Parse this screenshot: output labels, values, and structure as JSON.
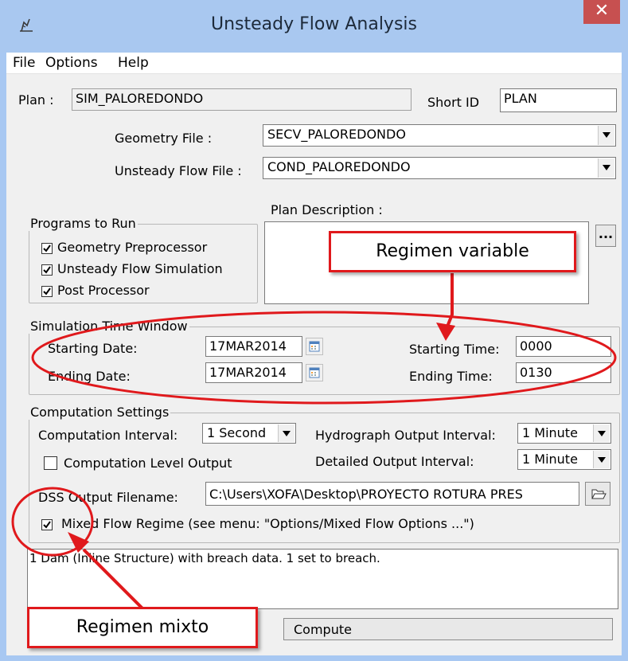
{
  "window": {
    "title": "Unsteady Flow Analysis",
    "close": "✕"
  },
  "menu": {
    "items": [
      "File",
      "Options",
      "Help"
    ]
  },
  "plan": {
    "label": "Plan :",
    "value": "SIM_PALOREDONDO",
    "short_id_label": "Short ID",
    "short_id": "PLAN"
  },
  "geometry": {
    "label": "Geometry File :",
    "value": "SECV_PALOREDONDO"
  },
  "unsteady": {
    "label": "Unsteady Flow File :",
    "value": "COND_PALOREDONDO"
  },
  "programs": {
    "title": "Programs to Run",
    "items": [
      {
        "label": "Geometry Preprocessor",
        "checked": true
      },
      {
        "label": "Unsteady Flow Simulation",
        "checked": true
      },
      {
        "label": "Post Processor",
        "checked": true
      }
    ]
  },
  "description": {
    "label": "Plan Description :",
    "ellipsis": "..."
  },
  "time_window": {
    "title": "Simulation Time Window",
    "start_date_label": "Starting Date:",
    "start_date": "17MAR2014",
    "end_date_label": "Ending Date:",
    "end_date": "17MAR2014",
    "start_time_label": "Starting Time:",
    "start_time": "0000",
    "end_time_label": "Ending Time:",
    "end_time": "0130"
  },
  "computation": {
    "title": "Computation Settings",
    "interval_label": "Computation Interval:",
    "interval": "1 Second",
    "hydro_label": "Hydrograph Output Interval:",
    "hydro": "1 Minute",
    "level_output_label": "Computation Level Output",
    "detailed_label": "Detailed Output Interval:",
    "detailed": "1 Minute",
    "dss_label": "DSS Output Filename:",
    "dss": "C:\\Users\\XOFA\\Desktop\\PROYECTO ROTURA PRES",
    "mixed_label": "Mixed Flow Regime (see menu: \"Options/Mixed Flow Options ...\")"
  },
  "status_text": "1 Dam (Inline Structure) with breach data. 1 set to breach.",
  "compute_button": "Compute",
  "annotations": {
    "regimen_variable": "Regimen variable",
    "regimen_mixto": "Regimen mixto"
  },
  "colors": {
    "callout": "#e0191c",
    "titlebar": "#a9c8f0",
    "close": "#c75050"
  }
}
